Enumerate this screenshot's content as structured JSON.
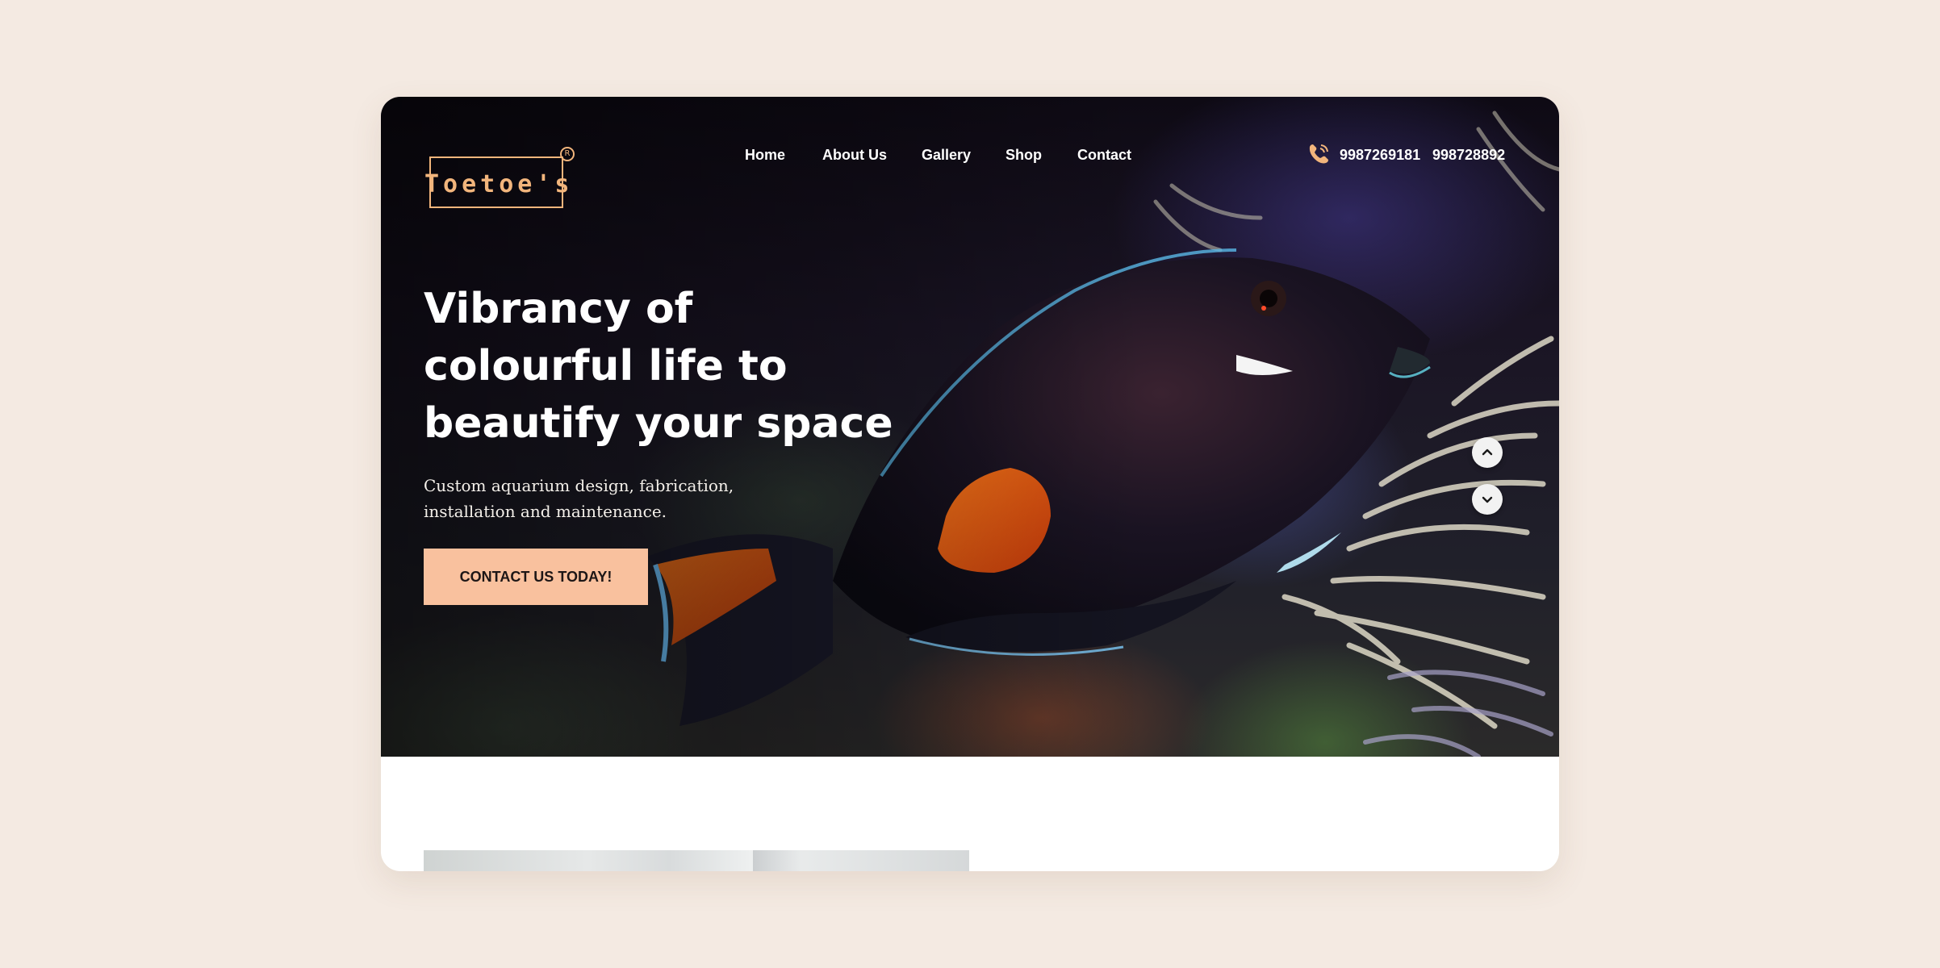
{
  "brand": {
    "logo_text": "Toetoe's",
    "logo_icon": "registered-mark-icon",
    "accent_color": "#f9c19e",
    "logo_color": "#f2b57c"
  },
  "nav": {
    "items": [
      {
        "label": "Home"
      },
      {
        "label": "About Us"
      },
      {
        "label": "Gallery"
      },
      {
        "label": "Shop"
      },
      {
        "label": "Contact"
      }
    ]
  },
  "contact": {
    "phone_icon": "phone-icon",
    "phones": [
      "9987269181",
      "998728892"
    ]
  },
  "hero": {
    "headline_lines": [
      "Vibrancy of",
      "colourful life to",
      "beautify your space"
    ],
    "subtext_lines": [
      "Custom aquarium design, fabrication,",
      "installation and maintenance."
    ],
    "cta_label": "CONTACT US TODAY!",
    "background_description": "dark aquarium reef with a dark surgeonfish with orange markings",
    "slider_up_icon": "chevron-up-icon",
    "slider_down_icon": "chevron-down-icon"
  },
  "colors": {
    "page_background": "#f4eae2",
    "cta_background": "#f9c19e",
    "headline_text": "#ffffff"
  }
}
